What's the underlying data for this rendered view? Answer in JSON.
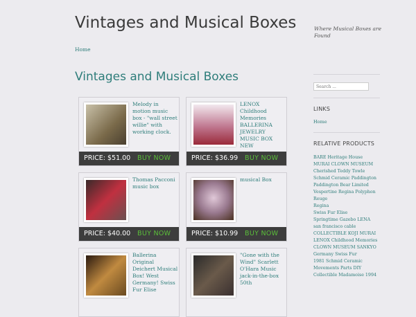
{
  "header": {
    "site_title": "Vintages and Musical Boxes",
    "tagline": "Where Musical Boxes are Found",
    "nav_home": "Home"
  },
  "main": {
    "page_title": "Vintages and Musical Boxes",
    "buy_label": "BUY NOW",
    "products": [
      {
        "title": "Melody in motion music box - \"wall street willie\" with working clock.",
        "price": "PRICE: $51.00",
        "thumb_color": "#9a8a6a"
      },
      {
        "title": "LENOX Childhood Memories BALLERINA JEWELRY MUSIC BOX NEW",
        "price": "PRICE: $36.99",
        "thumb_color": "#c9b8c0"
      },
      {
        "title": "Thomas Pacconi music box",
        "price": "PRICE: $40.00",
        "thumb_color": "#a03040"
      },
      {
        "title": "musical Box",
        "price": "PRICE: $10.99",
        "thumb_color": "#b89aa8"
      },
      {
        "title": "Ballerina Original Deichert Musical Box! West Germany! Swiss Fur Elise",
        "price": "",
        "thumb_color": "#8a6a3a"
      },
      {
        "title": "\"Gone with the Wind\" Scarlett O'Hara Music jack-in-the-box 50th",
        "price": "",
        "thumb_color": "#5a4a3a"
      }
    ]
  },
  "sidebar": {
    "search_placeholder": "Search ...",
    "links_title": "LINKS",
    "links_home": "Home",
    "related_title": "RELATIVE PRODUCTS",
    "related": [
      "BARE Heritage House",
      "MURAI CLOWN MUSEUM",
      "Cherished Teddy Towle",
      "Schmid Ceramic Paddington",
      "Paddington Bear Limited",
      "Vespertine Regina Polyphon",
      "Reuge",
      "Regina",
      "Swiss Fur Elise",
      "Springtime Gazebo LENA",
      "san francisco cable",
      "COLLECTIBLE KOJI MURAI",
      "LENOX Childhood Memories",
      "CLOWN MUSEUM SANKYO",
      "Germany Swiss Fur",
      "1981 Schmid Ceramic",
      "Movements Parts DIY",
      "Collectible Madamoise 1994"
    ]
  },
  "colors": {
    "accent": "#2e7d7a",
    "buy": "#5bbf3a",
    "bar": "#3d3d3d"
  }
}
